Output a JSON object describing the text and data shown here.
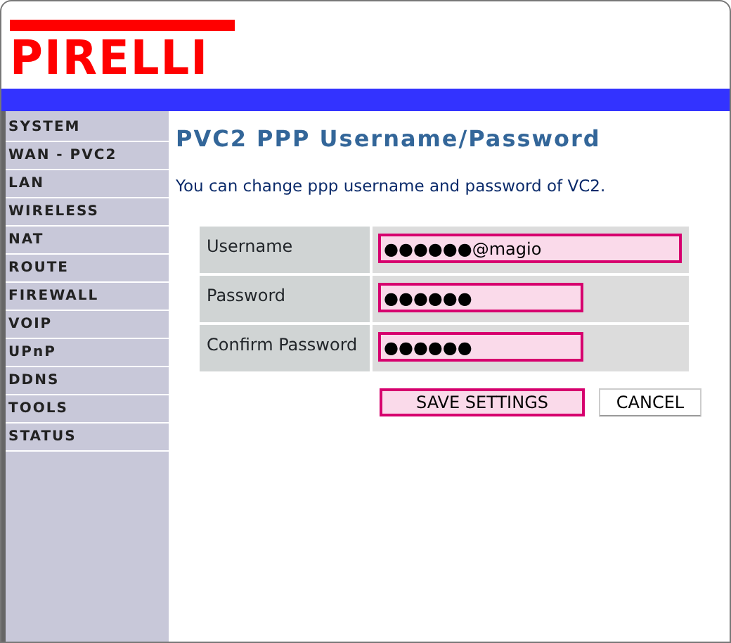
{
  "logo": {
    "text": "PIRELLI"
  },
  "sidebar": {
    "items": [
      {
        "label": "SYSTEM"
      },
      {
        "label": "WAN - PVC2"
      },
      {
        "label": "LAN"
      },
      {
        "label": "WIRELESS"
      },
      {
        "label": "NAT"
      },
      {
        "label": "ROUTE"
      },
      {
        "label": "FIREWALL"
      },
      {
        "label": "VOIP"
      },
      {
        "label": "UPnP"
      },
      {
        "label": "DDNS"
      },
      {
        "label": "TOOLS"
      },
      {
        "label": "STATUS"
      }
    ]
  },
  "title": "PVC2 PPP Username/Password",
  "description": "You can change ppp username and password of VC2.",
  "form": {
    "fields": [
      {
        "label": "Username",
        "value": "●●●●●●@magio",
        "kind": "wide"
      },
      {
        "label": "Password",
        "value": "●●●●●●",
        "kind": "short"
      },
      {
        "label": "Confirm Password",
        "value": "●●●●●●",
        "kind": "short"
      }
    ]
  },
  "buttons": [
    {
      "label": "SAVE SETTINGS",
      "kind": "primary"
    },
    {
      "label": "CANCEL",
      "kind": "plain"
    }
  ]
}
